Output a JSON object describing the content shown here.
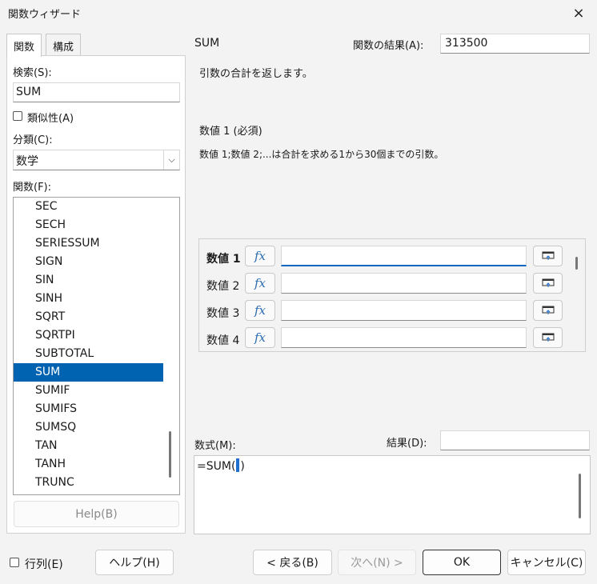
{
  "window": {
    "title": "関数ウィザード",
    "close_icon": "×"
  },
  "tabs": [
    {
      "label": "関数"
    },
    {
      "label": "構成"
    }
  ],
  "search": {
    "label": "検索(S):",
    "value": "SUM"
  },
  "similar": {
    "label": "類似性(A)",
    "checked": false
  },
  "category": {
    "label": "分類(C):",
    "value": "数学",
    "arrow": "⌵"
  },
  "functions": {
    "label": "関数(F):",
    "items": [
      "SEC",
      "SECH",
      "SERIESSUM",
      "SIGN",
      "SIN",
      "SINH",
      "SQRT",
      "SQRTPI",
      "SUBTOTAL",
      "SUM",
      "SUMIF",
      "SUMIFS",
      "SUMSQ",
      "TAN",
      "TANH",
      "TRUNC"
    ],
    "selected": "SUM"
  },
  "help_disabled": {
    "label": "Help(B)"
  },
  "function_name": "SUM",
  "function_result": {
    "label": "関数の結果(A):",
    "value": "313500"
  },
  "description": "引数の合計を返します。",
  "param": {
    "title": "数値 1 (必須)",
    "text": "数値 1;数値 2;...は合計を求める1から30個までの引数。"
  },
  "arguments": [
    {
      "label": "数値 1",
      "value": "",
      "fx": "fx"
    },
    {
      "label": "数値 2",
      "value": "",
      "fx": "fx"
    },
    {
      "label": "数値 3",
      "value": "",
      "fx": "fx"
    },
    {
      "label": "数値 4",
      "value": "",
      "fx": "fx"
    }
  ],
  "formula": {
    "label": "数式(M):",
    "before": "=SUM(",
    "after": ")"
  },
  "result": {
    "label": "結果(D):",
    "value": ""
  },
  "array": {
    "label": "行列(E)",
    "checked": false
  },
  "buttons": {
    "help": "ヘルプ(H)",
    "back": "< 戻る(B)",
    "next": "次へ(N) >",
    "ok": "OK",
    "cancel": "キャンセル(C)"
  }
}
